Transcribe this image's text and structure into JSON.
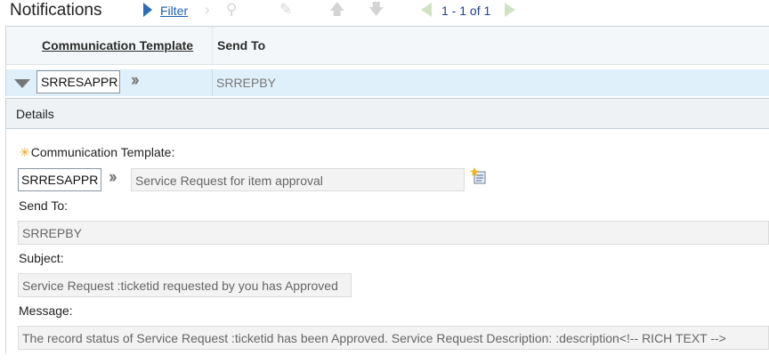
{
  "header": {
    "title": "Notifications",
    "filter_label": "Filter",
    "pager_text": "1 - 1 of 1",
    "icons": [
      "filter-arrow-icon",
      "chevron-right-icon",
      "search-icon",
      "clear-filter-icon",
      "arrow-up-icon",
      "arrow-down-icon",
      "previous-page-icon",
      "next-page-icon"
    ]
  },
  "table": {
    "columns": [
      "Communication Template",
      "Send To"
    ],
    "rows": [
      {
        "template": "SRRESAPPR",
        "send_to": "SRREPBY"
      }
    ]
  },
  "details": {
    "section_label": "Details",
    "template_label": "Communication Template:",
    "template_value": "SRRESAPPR",
    "template_description": "Service Request for item approval",
    "send_to_label": "Send To:",
    "send_to_value": "SRREPBY",
    "subject_label": "Subject:",
    "subject_value": "Service Request :ticketid requested by you has Approved",
    "message_label": "Message:",
    "message_value": "The record status of Service Request :ticketid has been Approved.     Service Request Description:    :description<!-- RICH TEXT -->"
  },
  "colors": {
    "link": "#1d5fb0",
    "row_highlight": "#e0f0fa",
    "required_marker": "#f2a31b",
    "pager_arrow": "#cfe3c3"
  }
}
